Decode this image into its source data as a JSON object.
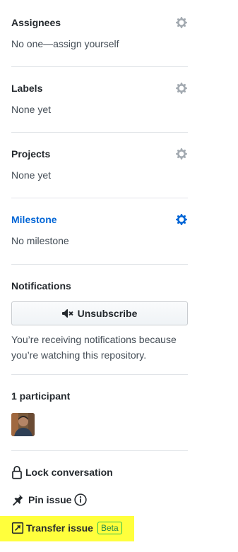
{
  "assignees": {
    "title": "Assignees",
    "value": "No one—assign yourself"
  },
  "labels": {
    "title": "Labels",
    "value": "None yet"
  },
  "projects": {
    "title": "Projects",
    "value": "None yet"
  },
  "milestone": {
    "title": "Milestone",
    "value": "No milestone"
  },
  "notifications": {
    "title": "Notifications",
    "button_label": "Unsubscribe",
    "reason": "You’re receiving notifications because you’re watching this repository."
  },
  "participants": {
    "title": "1 participant"
  },
  "actions": {
    "lock": "Lock conversation",
    "pin": "Pin issue",
    "transfer": "Transfer issue",
    "transfer_badge": "Beta"
  },
  "icons": {
    "gear": "gear-icon",
    "mute": "mute-icon",
    "lock": "lock-icon",
    "pin": "pin-icon",
    "info": "info-icon",
    "transfer": "transfer-icon"
  },
  "colors": {
    "link": "#0366d6",
    "gear_muted": "#a3aab1",
    "highlight": "#ffff3c",
    "beta": "#2cbe4e"
  }
}
